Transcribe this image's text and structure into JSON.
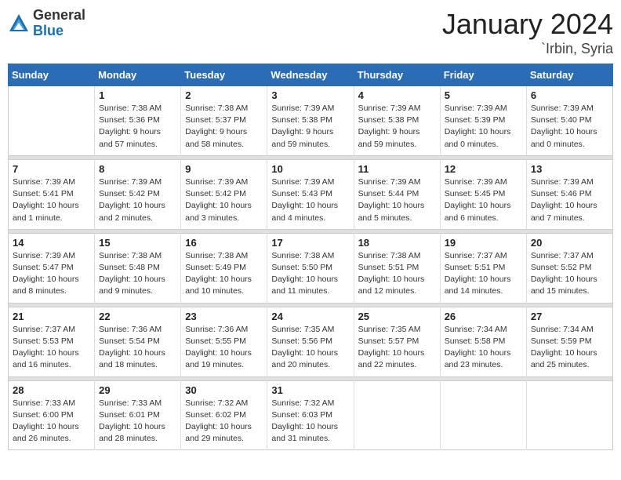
{
  "header": {
    "logo_general": "General",
    "logo_blue": "Blue",
    "title": "January 2024",
    "location": "`Irbin, Syria"
  },
  "weekdays": [
    "Sunday",
    "Monday",
    "Tuesday",
    "Wednesday",
    "Thursday",
    "Friday",
    "Saturday"
  ],
  "weeks": [
    [
      {
        "day": "",
        "sunrise": "",
        "sunset": "",
        "daylight": ""
      },
      {
        "day": "1",
        "sunrise": "Sunrise: 7:38 AM",
        "sunset": "Sunset: 5:36 PM",
        "daylight": "Daylight: 9 hours and 57 minutes."
      },
      {
        "day": "2",
        "sunrise": "Sunrise: 7:38 AM",
        "sunset": "Sunset: 5:37 PM",
        "daylight": "Daylight: 9 hours and 58 minutes."
      },
      {
        "day": "3",
        "sunrise": "Sunrise: 7:39 AM",
        "sunset": "Sunset: 5:38 PM",
        "daylight": "Daylight: 9 hours and 59 minutes."
      },
      {
        "day": "4",
        "sunrise": "Sunrise: 7:39 AM",
        "sunset": "Sunset: 5:38 PM",
        "daylight": "Daylight: 9 hours and 59 minutes."
      },
      {
        "day": "5",
        "sunrise": "Sunrise: 7:39 AM",
        "sunset": "Sunset: 5:39 PM",
        "daylight": "Daylight: 10 hours and 0 minutes."
      },
      {
        "day": "6",
        "sunrise": "Sunrise: 7:39 AM",
        "sunset": "Sunset: 5:40 PM",
        "daylight": "Daylight: 10 hours and 0 minutes."
      }
    ],
    [
      {
        "day": "7",
        "sunrise": "Sunrise: 7:39 AM",
        "sunset": "Sunset: 5:41 PM",
        "daylight": "Daylight: 10 hours and 1 minute."
      },
      {
        "day": "8",
        "sunrise": "Sunrise: 7:39 AM",
        "sunset": "Sunset: 5:42 PM",
        "daylight": "Daylight: 10 hours and 2 minutes."
      },
      {
        "day": "9",
        "sunrise": "Sunrise: 7:39 AM",
        "sunset": "Sunset: 5:42 PM",
        "daylight": "Daylight: 10 hours and 3 minutes."
      },
      {
        "day": "10",
        "sunrise": "Sunrise: 7:39 AM",
        "sunset": "Sunset: 5:43 PM",
        "daylight": "Daylight: 10 hours and 4 minutes."
      },
      {
        "day": "11",
        "sunrise": "Sunrise: 7:39 AM",
        "sunset": "Sunset: 5:44 PM",
        "daylight": "Daylight: 10 hours and 5 minutes."
      },
      {
        "day": "12",
        "sunrise": "Sunrise: 7:39 AM",
        "sunset": "Sunset: 5:45 PM",
        "daylight": "Daylight: 10 hours and 6 minutes."
      },
      {
        "day": "13",
        "sunrise": "Sunrise: 7:39 AM",
        "sunset": "Sunset: 5:46 PM",
        "daylight": "Daylight: 10 hours and 7 minutes."
      }
    ],
    [
      {
        "day": "14",
        "sunrise": "Sunrise: 7:39 AM",
        "sunset": "Sunset: 5:47 PM",
        "daylight": "Daylight: 10 hours and 8 minutes."
      },
      {
        "day": "15",
        "sunrise": "Sunrise: 7:38 AM",
        "sunset": "Sunset: 5:48 PM",
        "daylight": "Daylight: 10 hours and 9 minutes."
      },
      {
        "day": "16",
        "sunrise": "Sunrise: 7:38 AM",
        "sunset": "Sunset: 5:49 PM",
        "daylight": "Daylight: 10 hours and 10 minutes."
      },
      {
        "day": "17",
        "sunrise": "Sunrise: 7:38 AM",
        "sunset": "Sunset: 5:50 PM",
        "daylight": "Daylight: 10 hours and 11 minutes."
      },
      {
        "day": "18",
        "sunrise": "Sunrise: 7:38 AM",
        "sunset": "Sunset: 5:51 PM",
        "daylight": "Daylight: 10 hours and 12 minutes."
      },
      {
        "day": "19",
        "sunrise": "Sunrise: 7:37 AM",
        "sunset": "Sunset: 5:51 PM",
        "daylight": "Daylight: 10 hours and 14 minutes."
      },
      {
        "day": "20",
        "sunrise": "Sunrise: 7:37 AM",
        "sunset": "Sunset: 5:52 PM",
        "daylight": "Daylight: 10 hours and 15 minutes."
      }
    ],
    [
      {
        "day": "21",
        "sunrise": "Sunrise: 7:37 AM",
        "sunset": "Sunset: 5:53 PM",
        "daylight": "Daylight: 10 hours and 16 minutes."
      },
      {
        "day": "22",
        "sunrise": "Sunrise: 7:36 AM",
        "sunset": "Sunset: 5:54 PM",
        "daylight": "Daylight: 10 hours and 18 minutes."
      },
      {
        "day": "23",
        "sunrise": "Sunrise: 7:36 AM",
        "sunset": "Sunset: 5:55 PM",
        "daylight": "Daylight: 10 hours and 19 minutes."
      },
      {
        "day": "24",
        "sunrise": "Sunrise: 7:35 AM",
        "sunset": "Sunset: 5:56 PM",
        "daylight": "Daylight: 10 hours and 20 minutes."
      },
      {
        "day": "25",
        "sunrise": "Sunrise: 7:35 AM",
        "sunset": "Sunset: 5:57 PM",
        "daylight": "Daylight: 10 hours and 22 minutes."
      },
      {
        "day": "26",
        "sunrise": "Sunrise: 7:34 AM",
        "sunset": "Sunset: 5:58 PM",
        "daylight": "Daylight: 10 hours and 23 minutes."
      },
      {
        "day": "27",
        "sunrise": "Sunrise: 7:34 AM",
        "sunset": "Sunset: 5:59 PM",
        "daylight": "Daylight: 10 hours and 25 minutes."
      }
    ],
    [
      {
        "day": "28",
        "sunrise": "Sunrise: 7:33 AM",
        "sunset": "Sunset: 6:00 PM",
        "daylight": "Daylight: 10 hours and 26 minutes."
      },
      {
        "day": "29",
        "sunrise": "Sunrise: 7:33 AM",
        "sunset": "Sunset: 6:01 PM",
        "daylight": "Daylight: 10 hours and 28 minutes."
      },
      {
        "day": "30",
        "sunrise": "Sunrise: 7:32 AM",
        "sunset": "Sunset: 6:02 PM",
        "daylight": "Daylight: 10 hours and 29 minutes."
      },
      {
        "day": "31",
        "sunrise": "Sunrise: 7:32 AM",
        "sunset": "Sunset: 6:03 PM",
        "daylight": "Daylight: 10 hours and 31 minutes."
      },
      {
        "day": "",
        "sunrise": "",
        "sunset": "",
        "daylight": ""
      },
      {
        "day": "",
        "sunrise": "",
        "sunset": "",
        "daylight": ""
      },
      {
        "day": "",
        "sunrise": "",
        "sunset": "",
        "daylight": ""
      }
    ]
  ]
}
